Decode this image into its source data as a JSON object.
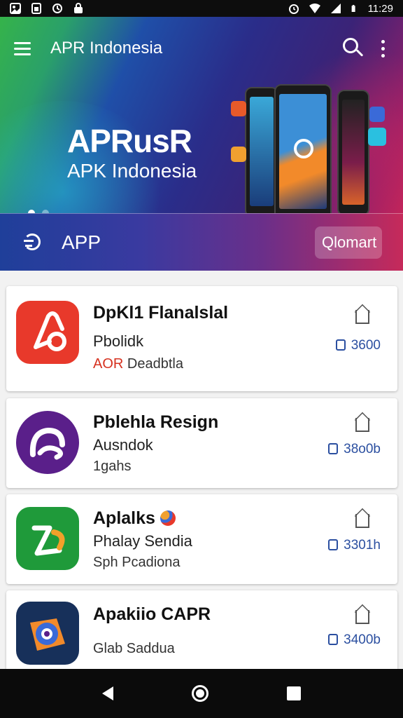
{
  "status_bar": {
    "time": "11:29",
    "left_icons": [
      "photo-icon",
      "sim-icon",
      "sync-icon",
      "lock-icon"
    ],
    "right_icons": [
      "alarm-icon",
      "wifi-icon",
      "signal-icon",
      "battery-icon"
    ]
  },
  "app_bar": {
    "title": "APR Indonesia",
    "menu_icon": "hamburger-menu-icon",
    "search_icon": "search-icon",
    "more_icon": "more-vert-icon"
  },
  "hero": {
    "title": "APRusR",
    "subtitle": "APK Indonesia",
    "slide_count": 2,
    "active_slide": 1
  },
  "category_bar": {
    "label": "APP",
    "button_label": "Qlomart"
  },
  "apps": [
    {
      "name": "DpKl1 Flanalslal",
      "line2": "Pbolidk",
      "line3_accent": "AOR",
      "line3": "Deadbtla",
      "size": "3600",
      "icon_color": "#e8392b"
    },
    {
      "name": "Pblehla Resign",
      "line2": "Ausndok",
      "line3_accent": "",
      "line3": "1gahs",
      "size": "38o0b",
      "icon_color": "#5a1f8a"
    },
    {
      "name": "Aplalks",
      "line2": "Phalay Sendia",
      "line3_accent": "",
      "line3": "Sph Pcadiona",
      "size": "3301h",
      "icon_color": "#1f9a3a"
    },
    {
      "name": "Apakiio CAPR",
      "line2": "",
      "line3_accent": "",
      "line3": "Glab Saddua",
      "size": "3400b",
      "icon_color": "#17305a"
    }
  ],
  "nav_bar": {
    "back_icon": "back-icon",
    "home_icon": "home-icon",
    "recents_icon": "recents-icon"
  }
}
